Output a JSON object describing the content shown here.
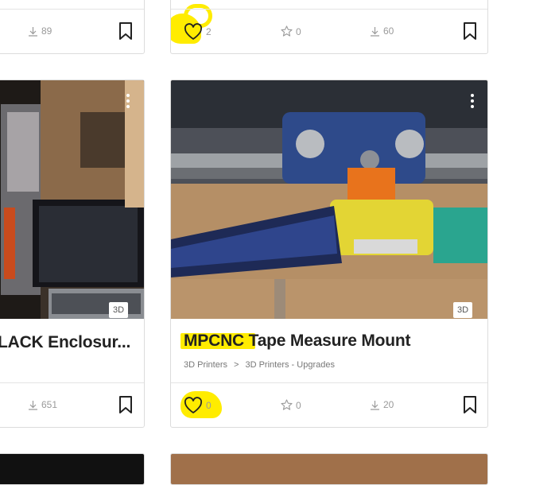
{
  "cards": {
    "top_left": {
      "downloads": "89"
    },
    "top_right": {
      "likes": "2",
      "favorites": "0",
      "downloads": "60"
    },
    "mid_left": {
      "title": "LACK Enclosur...",
      "badge": "3D",
      "downloads": "651"
    },
    "mid_right": {
      "title_highlight": "MPCNC",
      "title_rest": " Tape Measure Mount",
      "badge": "3D",
      "breadcrumb": [
        "3D Printers",
        ">",
        "3D Printers - Upgrades"
      ],
      "likes": "0",
      "favorites": "0",
      "downloads": "20"
    }
  },
  "colors": {
    "highlight": "#ffec00",
    "border": "#dcdcdc",
    "muted": "#9a9a9a"
  },
  "icons": [
    "heart-icon",
    "star-icon",
    "download-icon",
    "bookmark-icon",
    "more-options-icon"
  ]
}
